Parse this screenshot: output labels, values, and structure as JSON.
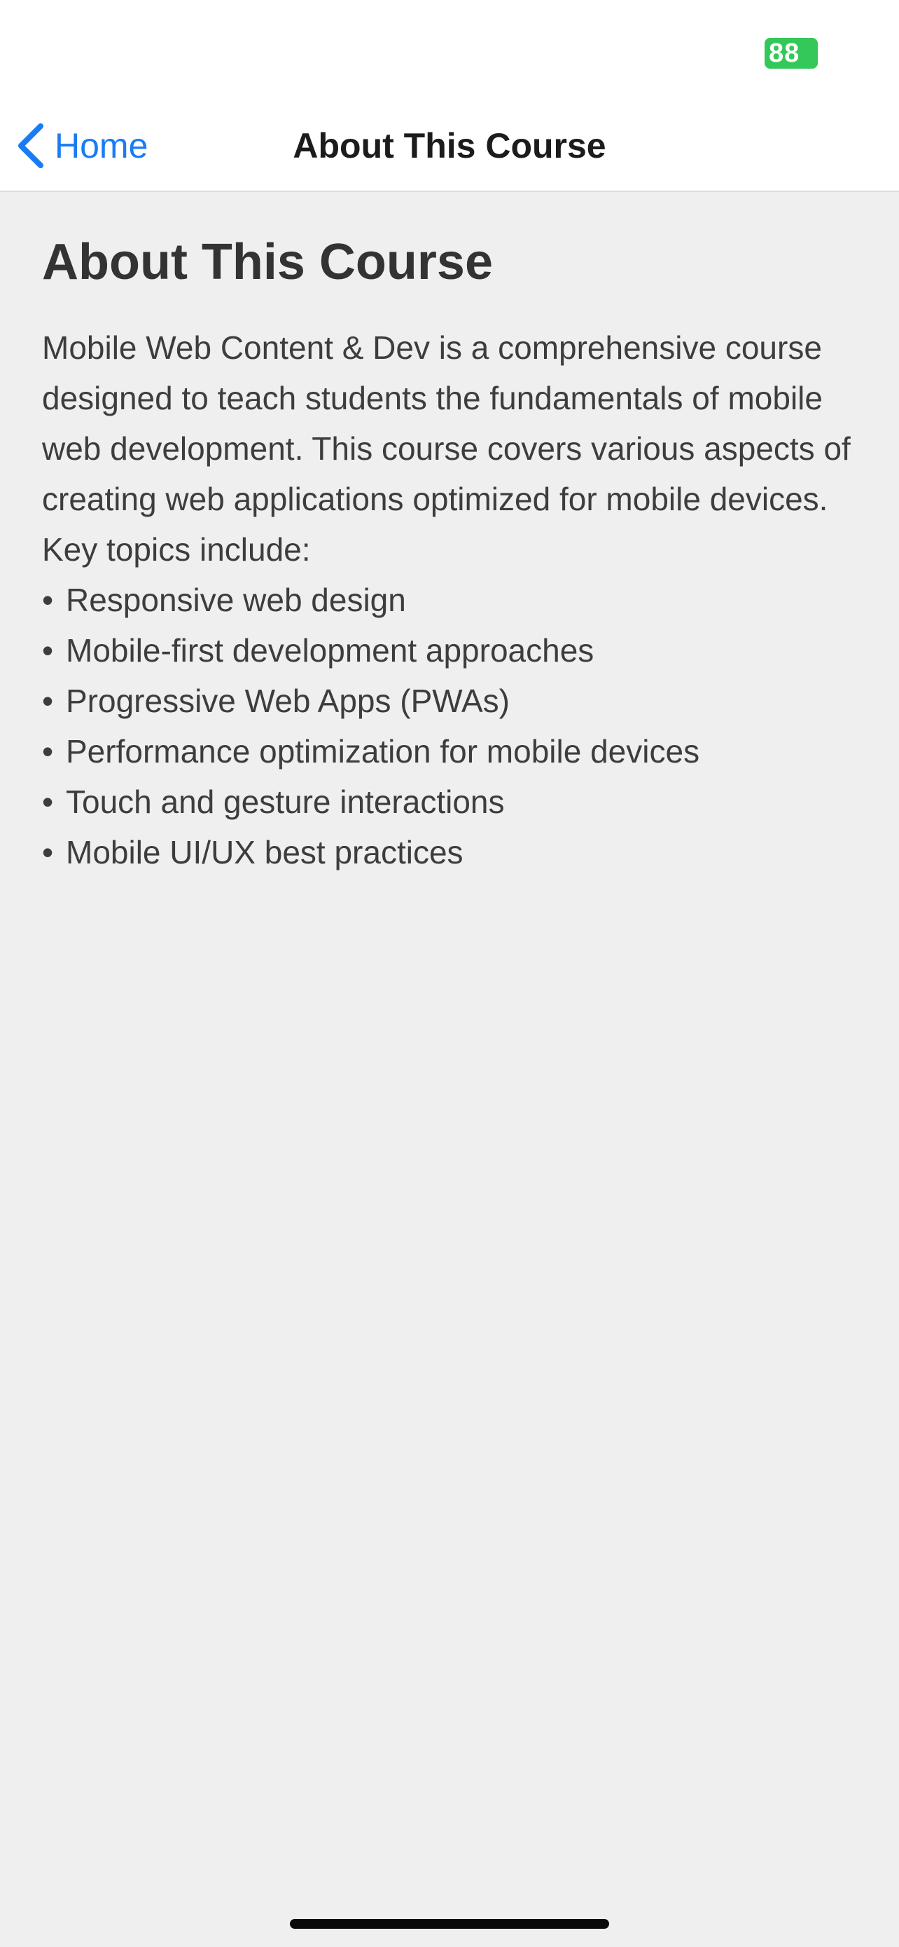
{
  "status_bar": {
    "battery_text": "88",
    "battery_color": "#34c759"
  },
  "nav": {
    "back_label": "Home",
    "back_icon": "chevron-left-icon",
    "title": "About This Course",
    "accent_color": "#1a7cf4"
  },
  "main": {
    "heading": "About This Course",
    "description": "Mobile Web Content & Dev is a comprehensive course designed to teach students the fundamentals of mobile web development. This course covers various aspects of creating web applications optimized for mobile devices. Key topics include:",
    "bullet_char": "•",
    "topics": [
      "Responsive web design",
      "Mobile-first development approaches",
      "Progressive Web Apps (PWAs)",
      "Performance optimization for mobile devices",
      "Touch and gesture interactions",
      "Mobile UI/UX best practices"
    ]
  }
}
